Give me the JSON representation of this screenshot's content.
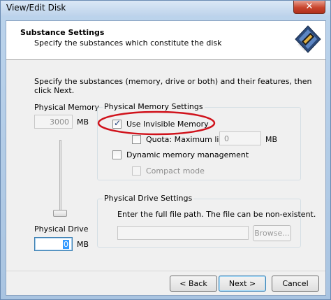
{
  "window": {
    "title": "View/Edit Disk",
    "close_glyph": "✕"
  },
  "header": {
    "title": "Substance Settings",
    "subtitle": "Specify the substances which constitute the disk",
    "icon": "memory-chip-icon"
  },
  "instruction": "Specify the substances (memory, drive or both) and their features, then click Next.",
  "left_panel": {
    "physical_memory_label": "Physical Memory",
    "memory_value": "3000",
    "memory_unit": "MB",
    "physical_drive_label": "Physical Drive",
    "drive_value": "0",
    "drive_unit": "MB"
  },
  "memory_settings": {
    "group_label": "Physical Memory Settings",
    "use_invisible_memory": {
      "label": "Use Invisible Memory",
      "checked": true
    },
    "quota": {
      "label": "Quota: Maximum limit",
      "checked": false,
      "value": "0",
      "unit": "MB"
    },
    "dynamic_memory": {
      "label": "Dynamic memory management",
      "checked": false
    },
    "compact_mode": {
      "label": "Compact mode",
      "checked": false
    }
  },
  "drive_settings": {
    "group_label": "Physical Drive Settings",
    "instruction": "Enter the full file path. The file can be non-existent.",
    "path_value": "",
    "browse_label": "Browse..."
  },
  "footer": {
    "back_label": "< Back",
    "next_label": "Next >",
    "cancel_label": "Cancel"
  },
  "colors": {
    "annotation_ring": "#d0121b",
    "accent": "#3c7fb1"
  }
}
